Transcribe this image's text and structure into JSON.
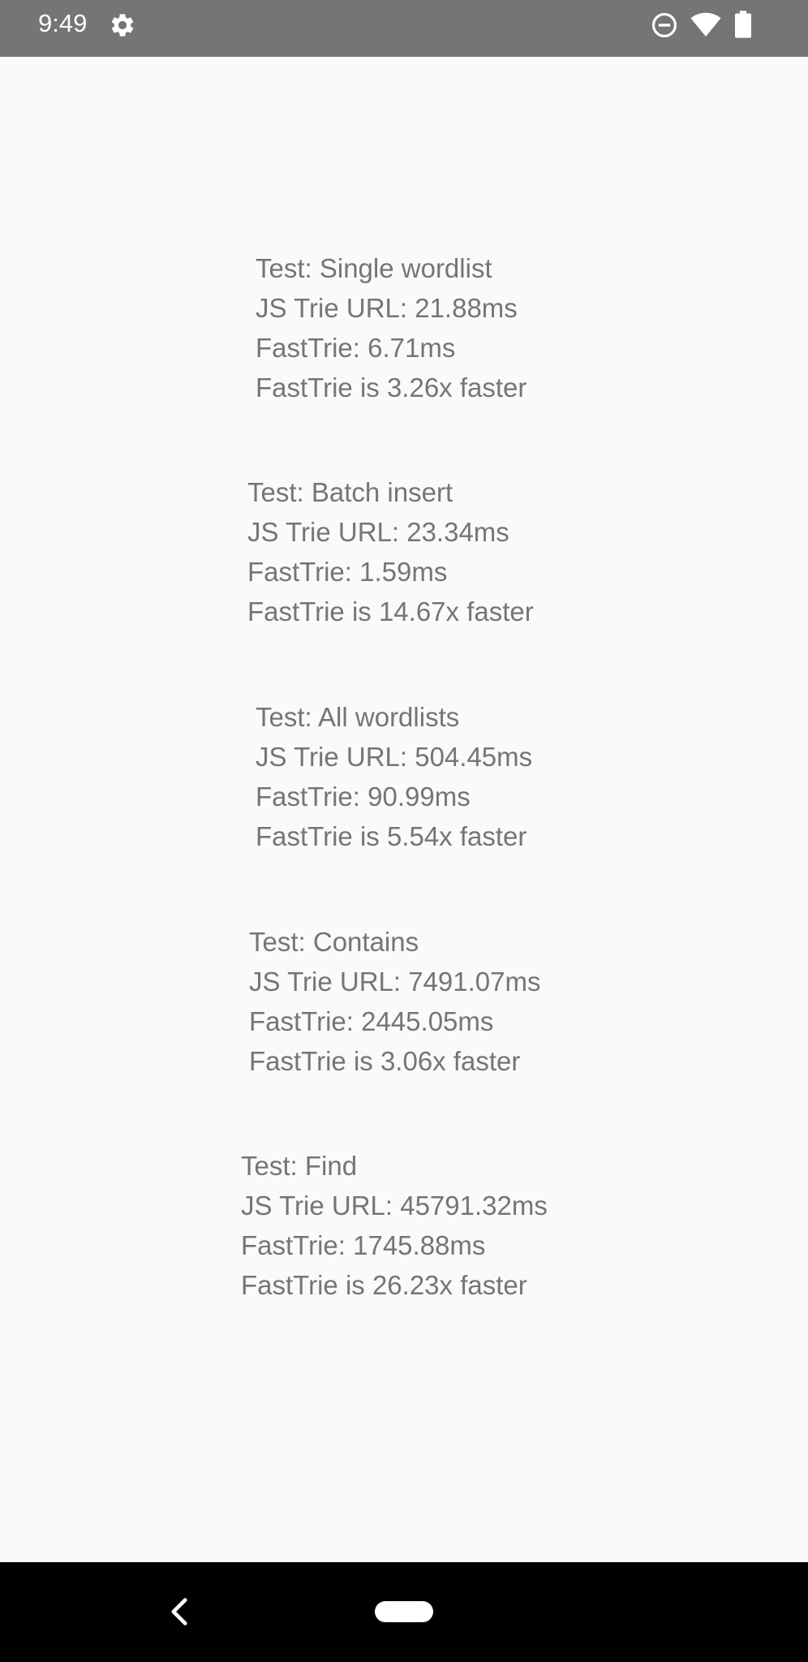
{
  "status_bar": {
    "time": "9:49",
    "icons": [
      "gear-icon",
      "do-not-disturb-icon",
      "wifi-icon",
      "battery-icon"
    ],
    "background": "#757575"
  },
  "tests": [
    {
      "title": "Test: Single wordlist",
      "js_trie": "JS Trie URL: 21.88ms",
      "fast_trie": "FastTrie: 6.71ms",
      "summary": "FastTrie is 3.26x faster"
    },
    {
      "title": "Test: Batch insert",
      "js_trie": "JS Trie URL: 23.34ms",
      "fast_trie": "FastTrie: 1.59ms",
      "summary": "FastTrie is 14.67x faster"
    },
    {
      "title": "Test: All wordlists",
      "js_trie": "JS Trie URL: 504.45ms",
      "fast_trie": "FastTrie: 90.99ms",
      "summary": "FastTrie is 5.54x faster"
    },
    {
      "title": "Test: Contains",
      "js_trie": "JS Trie URL: 7491.07ms",
      "fast_trie": "FastTrie: 2445.05ms",
      "summary": "FastTrie is 3.06x faster"
    },
    {
      "title": "Test: Find",
      "js_trie": "JS Trie URL: 45791.32ms",
      "fast_trie": "FastTrie: 1745.88ms",
      "summary": "FastTrie is 26.23x faster"
    }
  ],
  "colors": {
    "text": "#757575",
    "background": "#fafafa",
    "nav_bar": "#000000"
  },
  "nav_bar": {
    "icons": [
      "back-icon",
      "home-pill-icon"
    ]
  }
}
